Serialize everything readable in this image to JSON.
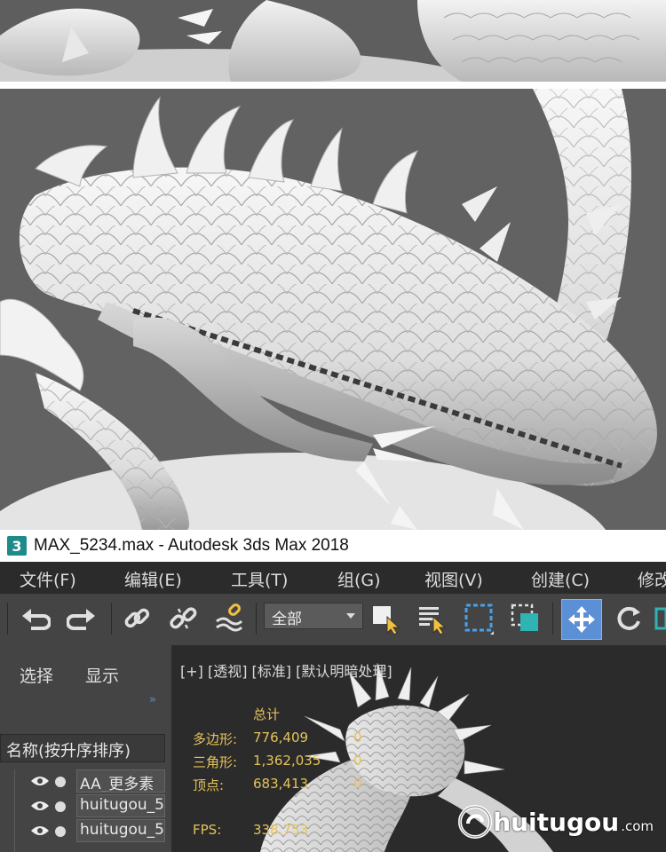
{
  "window": {
    "title": "MAX_5234.max - Autodesk 3ds Max 2018",
    "logo_glyph": "3"
  },
  "menu": [
    {
      "label": "文件(F)"
    },
    {
      "label": "编辑(E)"
    },
    {
      "label": "工具(T)"
    },
    {
      "label": "组(G)"
    },
    {
      "label": "视图(V)"
    },
    {
      "label": "创建(C)"
    },
    {
      "label": "修改"
    }
  ],
  "toolbar": {
    "selection_filter": "全部",
    "icons": [
      "undo-icon",
      "redo-icon",
      "link-icon",
      "unlink-icon",
      "bind-spacewarp-icon",
      "select-object-icon",
      "select-by-name-icon",
      "rectangular-selection-icon",
      "window-crossing-icon",
      "select-and-move-icon",
      "select-and-rotate-icon"
    ]
  },
  "scene_explorer": {
    "tabs": [
      "选择",
      "显示"
    ],
    "column_header": "名称(按升序排序)",
    "objects": [
      "AA_更多素",
      "huitugou_5",
      "huitugou_5"
    ]
  },
  "viewport": {
    "label": "[+] [透视] [标准] [默认明暗处理]",
    "stats": {
      "header": "总计",
      "rows": [
        {
          "label": "多边形:",
          "total": "776,409",
          "selected": "0"
        },
        {
          "label": "三角形:",
          "total": "1,362,035",
          "selected": "0"
        },
        {
          "label": "顶点:",
          "total": "683,413",
          "selected": "0"
        }
      ],
      "fps_label": "FPS:",
      "fps_value": "338.753"
    },
    "watermark": {
      "text": "huitugou",
      "suffix": ".com"
    }
  },
  "colors": {
    "menubar_bg": "#2b2b2b",
    "toolbar_bg": "#444444",
    "active_tool": "#5b8fd6",
    "stats_text": "#e6c25a",
    "render_bg": "#626262"
  }
}
